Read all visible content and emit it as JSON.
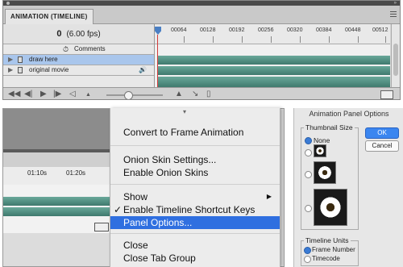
{
  "timeline": {
    "tab_title": "ANIMATION (TIMELINE)",
    "frame_display": "0",
    "fps": "(6.00 fps)",
    "ruler_ticks": [
      "00064",
      "00128",
      "00192",
      "00256",
      "00320",
      "00384",
      "00448",
      "00512"
    ],
    "layers": [
      {
        "label": "Comments"
      },
      {
        "label": "draw here"
      },
      {
        "label": "original movie"
      }
    ],
    "sound_icon": "🔊"
  },
  "bottom_panel": {
    "ruler_ticks": [
      "01:10s",
      "01:20s"
    ]
  },
  "menu": {
    "items": [
      {
        "label": "Convert to Frame Animation"
      },
      {
        "label": "Onion Skin Settings..."
      },
      {
        "label": "Enable Onion Skins"
      },
      {
        "label": "Show"
      },
      {
        "label": "Enable Timeline Shortcut Keys",
        "checked": true
      },
      {
        "label": "Panel Options...",
        "selected": true
      },
      {
        "label": "Close"
      },
      {
        "label": "Close Tab Group"
      }
    ],
    "check_glyph": "✓",
    "submenu_glyph": "▶"
  },
  "dialog": {
    "title": "Animation Panel Options",
    "thumbnail_group_label": "Thumbnail Size",
    "none_label": "None",
    "ok_label": "OK",
    "cancel_label": "Cancel",
    "units_group_label": "Timeline Units",
    "frame_number_label": "Frame Number",
    "timecode_label": "Timecode"
  },
  "colors": {
    "accent": "#2f6fe0",
    "track": "#4f8b7e",
    "playhead_line": "#d23c3c"
  }
}
